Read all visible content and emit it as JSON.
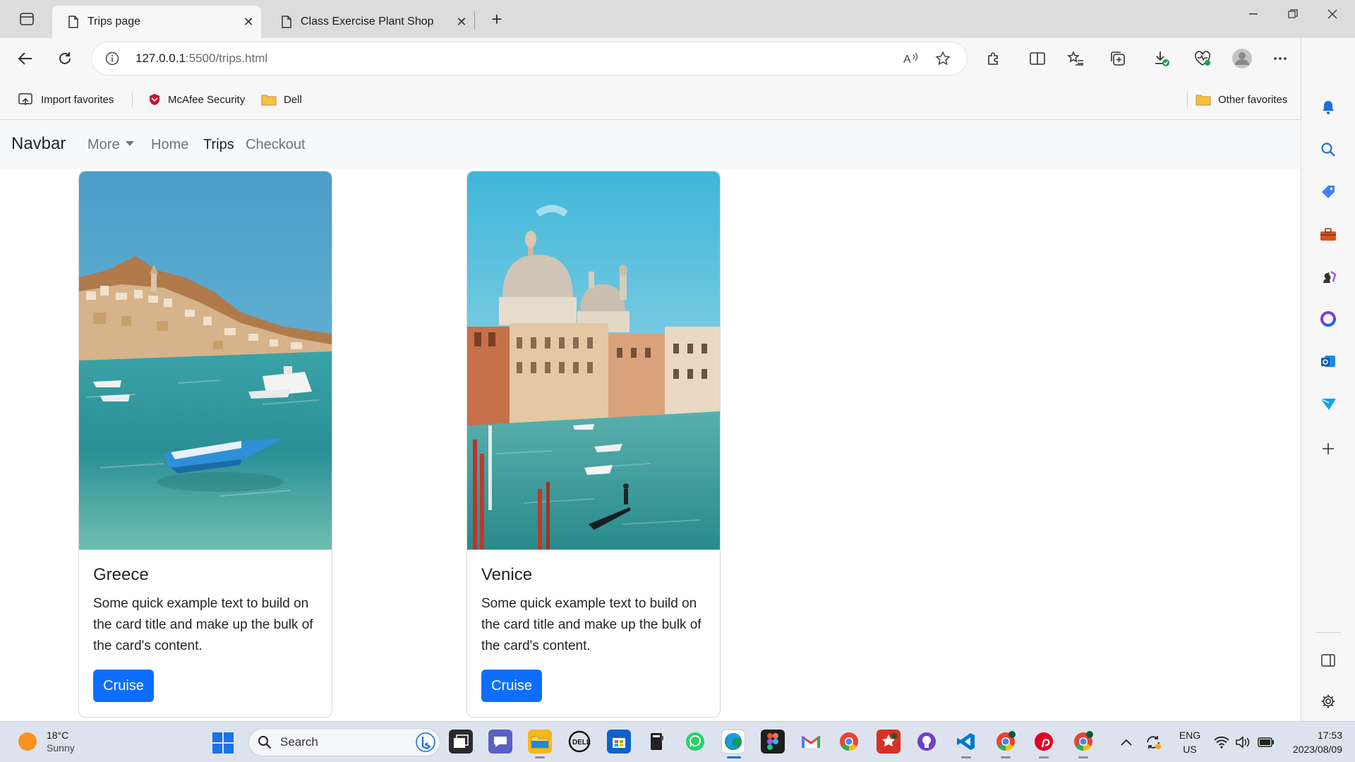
{
  "browser": {
    "tabs": [
      {
        "title": "Trips page",
        "active": true
      },
      {
        "title": "Class Exercise Plant Shop",
        "active": false
      }
    ],
    "address": {
      "host": "127.0.0.1",
      "rest": ":5500/trips.html"
    },
    "favorites": [
      {
        "label": "Import favorites",
        "icon": "import-icon"
      },
      {
        "label": "McAfee Security",
        "icon": "mcafee-icon"
      },
      {
        "label": "Dell",
        "icon": "folder-icon"
      }
    ],
    "other_favorites": "Other favorites"
  },
  "page": {
    "navbar": {
      "brand": "Navbar",
      "links": [
        {
          "label": "More",
          "dropdown": true
        },
        {
          "label": "Home"
        },
        {
          "label": "Trips",
          "active": true
        },
        {
          "label": "Checkout"
        }
      ]
    },
    "cards": [
      {
        "title": "Greece",
        "text": "Some quick example text to build on the card title and make up the bulk of the card's content.",
        "button": "Cruise"
      },
      {
        "title": "Venice",
        "text": "Some quick example text to build on the card title and make up the bulk of the card's content.",
        "button": "Cruise"
      }
    ]
  },
  "taskbar": {
    "weather": {
      "temp": "18°C",
      "condition": "Sunny"
    },
    "search_placeholder": "Search",
    "language": {
      "line1": "ENG",
      "line2": "US"
    },
    "time": "17:53",
    "date": "2023/08/09"
  },
  "colors": {
    "primary_button": "#0d6efd",
    "navbar_bg": "#f8f9fa",
    "tabstrip_bg": "#dcdcdc",
    "taskbar_bg": "#dde3ee"
  }
}
